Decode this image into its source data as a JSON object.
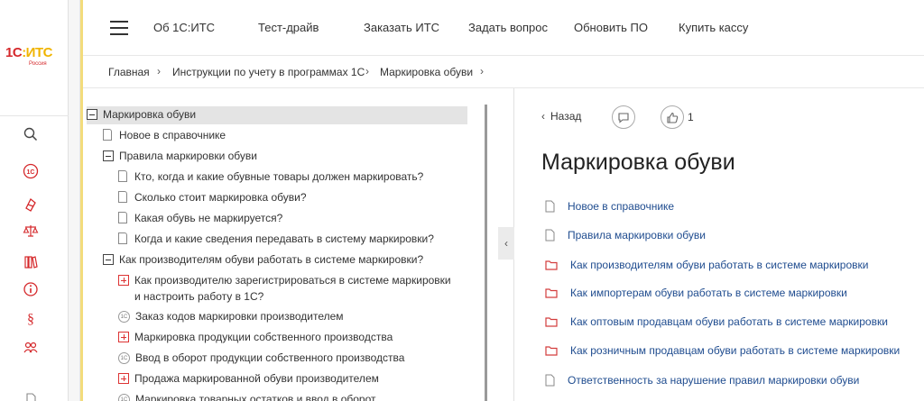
{
  "logo": {
    "text_a": "1С",
    "text_b": ":ИТС",
    "sub": "Россия"
  },
  "rail_icons": [
    "search-icon",
    "1c-icon",
    "shield-icon",
    "scales-icon",
    "books-icon",
    "info-icon",
    "paragraph-icon",
    "people-icon"
  ],
  "colors": {
    "brand_red": "#d5282b",
    "link_blue": "#1f4c8f",
    "folder_red": "#d33d3d",
    "accent_yellow": "#f3dc7c"
  },
  "topnav": {
    "items": [
      "Об 1С:ИТС",
      "Тест-драйв",
      "Заказать ИТС",
      "Задать вопрос",
      "Обновить ПО",
      "Купить кассу"
    ]
  },
  "breadcrumb": [
    "Главная",
    "Инструкции по учету в программах 1С",
    "Маркировка обуви"
  ],
  "breadcrumb_sep": "›",
  "tree": [
    {
      "type": "minus",
      "label": "Маркировка обуви"
    },
    {
      "type": "doc",
      "label": "Новое в справочнике"
    },
    {
      "type": "minus",
      "label": "Правила маркировки обуви"
    },
    {
      "type": "doc",
      "label": "Кто, когда и какие обувные товары должен маркировать?"
    },
    {
      "type": "doc",
      "label": "Сколько стоит маркировка обуви?"
    },
    {
      "type": "doc",
      "label": "Какая обувь не маркируется?"
    },
    {
      "type": "doc",
      "label": "Когда и какие сведения передавать в систему маркировки?"
    },
    {
      "type": "minus",
      "label": "Как производителям обуви работать в системе маркировки?"
    },
    {
      "type": "plus",
      "label": "Как производителю зарегистрироваться в системе маркировки",
      "label2": "и настроить работу в 1С?"
    },
    {
      "type": "1c",
      "label": "Заказ кодов маркировки производителем"
    },
    {
      "type": "plus",
      "label": "Маркировка продукции собственного производства"
    },
    {
      "type": "1c",
      "label": "Ввод в оборот продукции собственного производства"
    },
    {
      "type": "plus",
      "label": "Продажа маркированной обуви производителем"
    },
    {
      "type": "1c",
      "label": "Маркировка товарных остатков и ввод в оборот"
    }
  ],
  "content": {
    "back_label": "Назад",
    "like_count": "1",
    "title": "Маркировка обуви",
    "links": [
      {
        "type": "doc",
        "label": "Новое в справочнике"
      },
      {
        "type": "doc",
        "label": "Правила маркировки обуви"
      },
      {
        "type": "folder",
        "label": "Как производителям обуви работать в системе маркировки"
      },
      {
        "type": "folder",
        "label": "Как импортерам обуви работать в системе маркировки"
      },
      {
        "type": "folder",
        "label": "Как оптовым продавцам обуви работать в системе маркировки"
      },
      {
        "type": "folder",
        "label": "Как розничным продавцам обуви работать в системе маркировки"
      },
      {
        "type": "doc",
        "label": "Ответственность за нарушение правил маркировки обуви"
      }
    ]
  }
}
